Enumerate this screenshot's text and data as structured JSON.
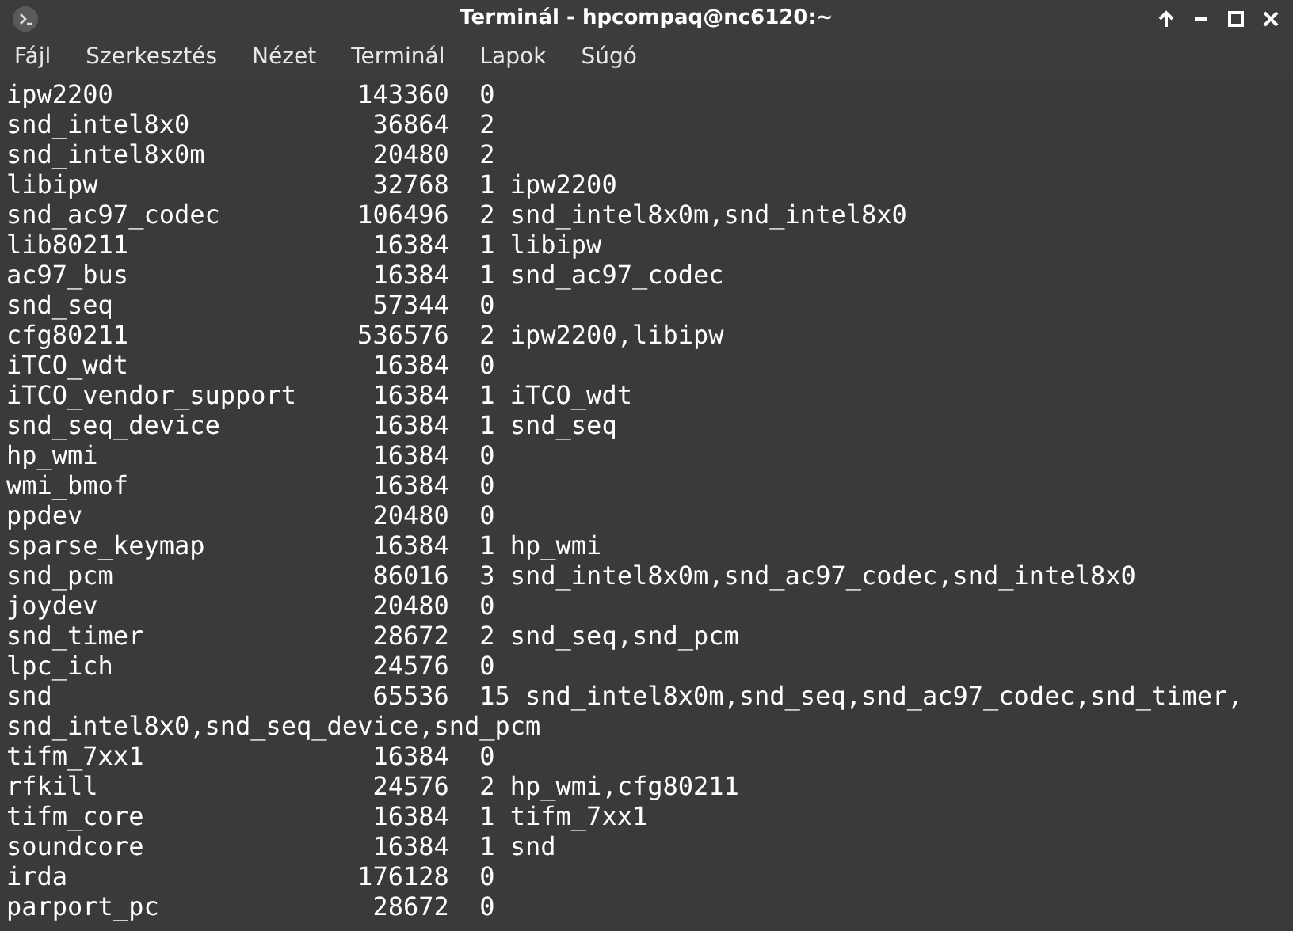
{
  "window": {
    "title": "Terminál - hpcompaq@nc6120:~"
  },
  "menu": [
    "Fájl",
    "Szerkesztés",
    "Nézet",
    "Terminál",
    "Lapok",
    "Súgó"
  ],
  "rows": [
    {
      "module": "ipw2200",
      "size": "143360",
      "used": "0",
      "by": ""
    },
    {
      "module": "snd_intel8x0",
      "size": "36864",
      "used": "2",
      "by": ""
    },
    {
      "module": "snd_intel8x0m",
      "size": "20480",
      "used": "2",
      "by": ""
    },
    {
      "module": "libipw",
      "size": "32768",
      "used": "1",
      "by": "ipw2200"
    },
    {
      "module": "snd_ac97_codec",
      "size": "106496",
      "used": "2",
      "by": "snd_intel8x0m,snd_intel8x0"
    },
    {
      "module": "lib80211",
      "size": "16384",
      "used": "1",
      "by": "libipw"
    },
    {
      "module": "ac97_bus",
      "size": "16384",
      "used": "1",
      "by": "snd_ac97_codec"
    },
    {
      "module": "snd_seq",
      "size": "57344",
      "used": "0",
      "by": ""
    },
    {
      "module": "cfg80211",
      "size": "536576",
      "used": "2",
      "by": "ipw2200,libipw"
    },
    {
      "module": "iTCO_wdt",
      "size": "16384",
      "used": "0",
      "by": ""
    },
    {
      "module": "iTCO_vendor_support",
      "size": "16384",
      "used": "1",
      "by": "iTCO_wdt"
    },
    {
      "module": "snd_seq_device",
      "size": "16384",
      "used": "1",
      "by": "snd_seq"
    },
    {
      "module": "hp_wmi",
      "size": "16384",
      "used": "0",
      "by": ""
    },
    {
      "module": "wmi_bmof",
      "size": "16384",
      "used": "0",
      "by": ""
    },
    {
      "module": "ppdev",
      "size": "20480",
      "used": "0",
      "by": ""
    },
    {
      "module": "sparse_keymap",
      "size": "16384",
      "used": "1",
      "by": "hp_wmi"
    },
    {
      "module": "snd_pcm",
      "size": "86016",
      "used": "3",
      "by": "snd_intel8x0m,snd_ac97_codec,snd_intel8x0"
    },
    {
      "module": "joydev",
      "size": "20480",
      "used": "0",
      "by": ""
    },
    {
      "module": "snd_timer",
      "size": "28672",
      "used": "2",
      "by": "snd_seq,snd_pcm"
    },
    {
      "module": "lpc_ich",
      "size": "24576",
      "used": "0",
      "by": ""
    },
    {
      "module": "snd",
      "size": "65536",
      "used": "15",
      "by": "snd_intel8x0m,snd_seq,snd_ac97_codec,snd_timer,snd_intel8x0,snd_seq_device,snd_pcm"
    },
    {
      "module": "tifm_7xx1",
      "size": "16384",
      "used": "0",
      "by": ""
    },
    {
      "module": "rfkill",
      "size": "24576",
      "used": "2",
      "by": "hp_wmi,cfg80211"
    },
    {
      "module": "tifm_core",
      "size": "16384",
      "used": "1",
      "by": "tifm_7xx1"
    },
    {
      "module": "soundcore",
      "size": "16384",
      "used": "1",
      "by": "snd"
    },
    {
      "module": "irda",
      "size": "176128",
      "used": "0",
      "by": ""
    },
    {
      "module": "parport_pc",
      "size": "28672",
      "used": "0",
      "by": ""
    }
  ]
}
